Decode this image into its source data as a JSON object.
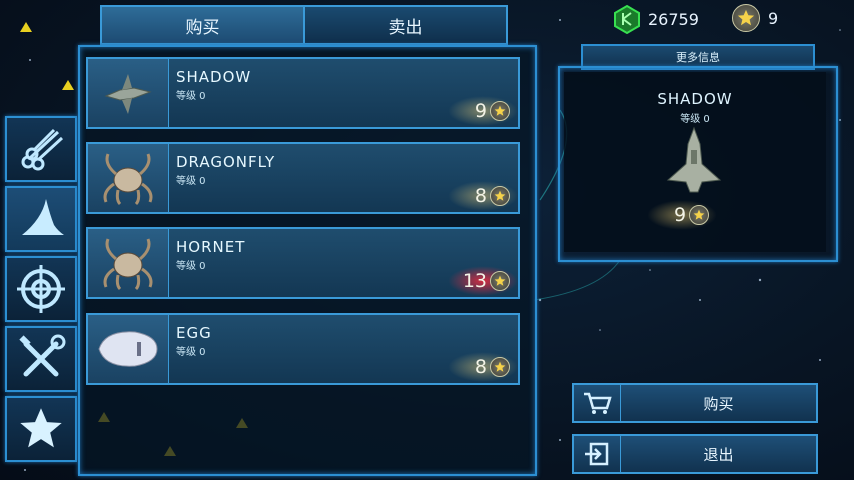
{
  "tabs": {
    "buy": "购买",
    "sell": "卖出"
  },
  "currency": {
    "gems": "26759",
    "stars": "9"
  },
  "side_icons": [
    "pipes-icon",
    "wing-icon",
    "target-icon",
    "tools-icon",
    "star-icon"
  ],
  "items": [
    {
      "name": "SHADOW",
      "level": "等级 0",
      "price": "9",
      "affordable": true
    },
    {
      "name": "DRAGONFLY",
      "level": "等级 0",
      "price": "8",
      "affordable": true
    },
    {
      "name": "HORNET",
      "level": "等级 0",
      "price": "13",
      "affordable": false
    },
    {
      "name": "EGG",
      "level": "等级 0",
      "price": "8",
      "affordable": true
    }
  ],
  "info": {
    "header": "更多信息",
    "name": "SHADOW",
    "level": "等级 0",
    "price": "9"
  },
  "buttons": {
    "buy": "购买",
    "exit": "退出"
  },
  "colors": {
    "border": "#3a9ad8",
    "gem": "#2ad24a",
    "red_glow": "#ff2a3c"
  }
}
